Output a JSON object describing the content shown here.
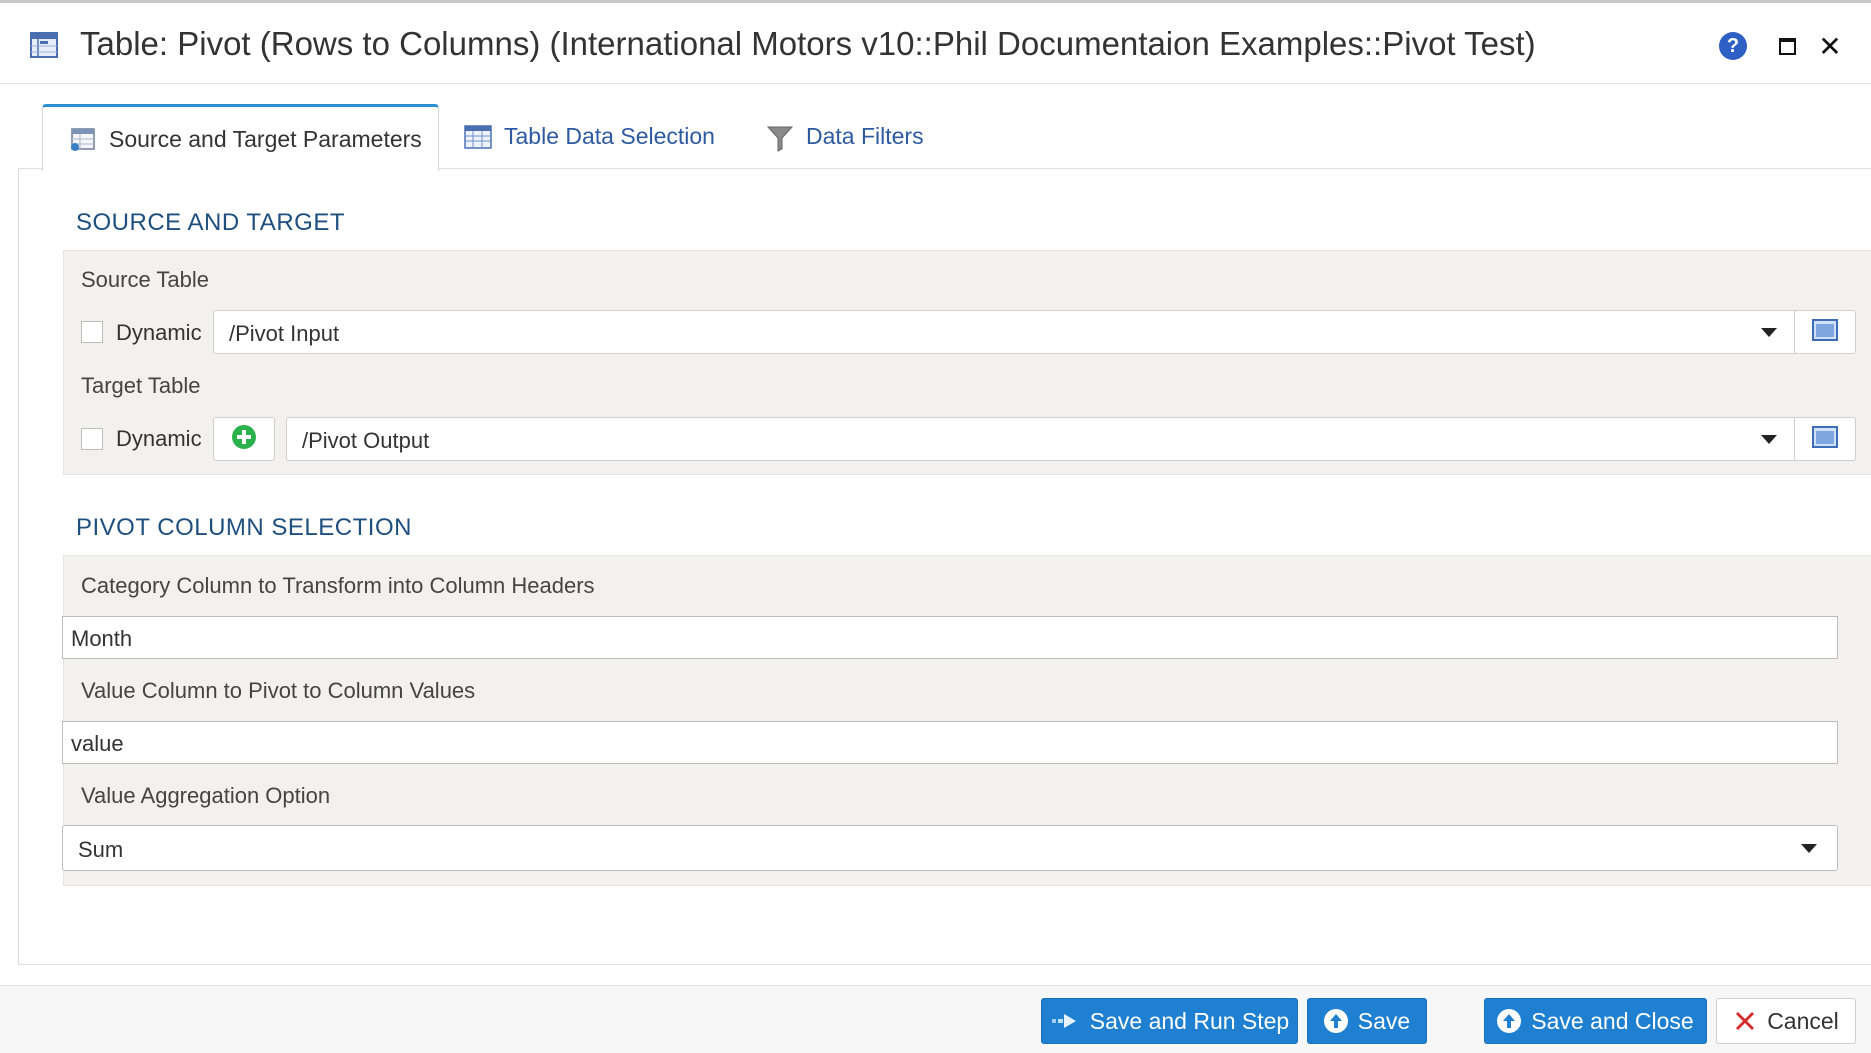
{
  "window": {
    "title": "Table: Pivot (Rows to Columns) (International Motors v10::Phil Documentaion Examples::Pivot Test)",
    "help_glyph": "?",
    "close_glyph": "✕",
    "icons": [
      "table-icon",
      "help-icon",
      "maximize-icon",
      "close-icon"
    ]
  },
  "tabs": [
    {
      "label": "Source and Target Parameters",
      "active": true,
      "icon": "table-settings-icon"
    },
    {
      "label": "Table Data Selection",
      "active": false,
      "icon": "table-grid-icon"
    },
    {
      "label": "Data Filters",
      "active": false,
      "icon": "funnel-icon"
    }
  ],
  "source_target": {
    "heading": "SOURCE AND TARGET",
    "source_label": "Source Table",
    "source_dynamic_label": "Dynamic",
    "source_dynamic_checked": false,
    "source_value": "/Pivot Input",
    "target_label": "Target Table",
    "target_dynamic_label": "Dynamic",
    "target_dynamic_checked": false,
    "target_value": "/Pivot Output"
  },
  "pivot": {
    "heading": "PIVOT COLUMN SELECTION",
    "category_label": "Category Column to Transform into Column Headers",
    "category_value": "Month",
    "value_label": "Value Column to Pivot to Column Values",
    "value_value": "value",
    "aggregation_label": "Value Aggregation Option",
    "aggregation_value": "Sum"
  },
  "footer": {
    "save_run_label": "Save and Run Step",
    "save_label": "Save",
    "save_close_label": "Save and Close",
    "cancel_label": "Cancel"
  },
  "colors": {
    "accent": "#1f7fd1",
    "heading": "#1e4f7e",
    "tab_link": "#2d5aa0",
    "group_bg": "#f2f1ee",
    "add_green": "#2bb24c",
    "cancel_red": "#d42a2a"
  }
}
